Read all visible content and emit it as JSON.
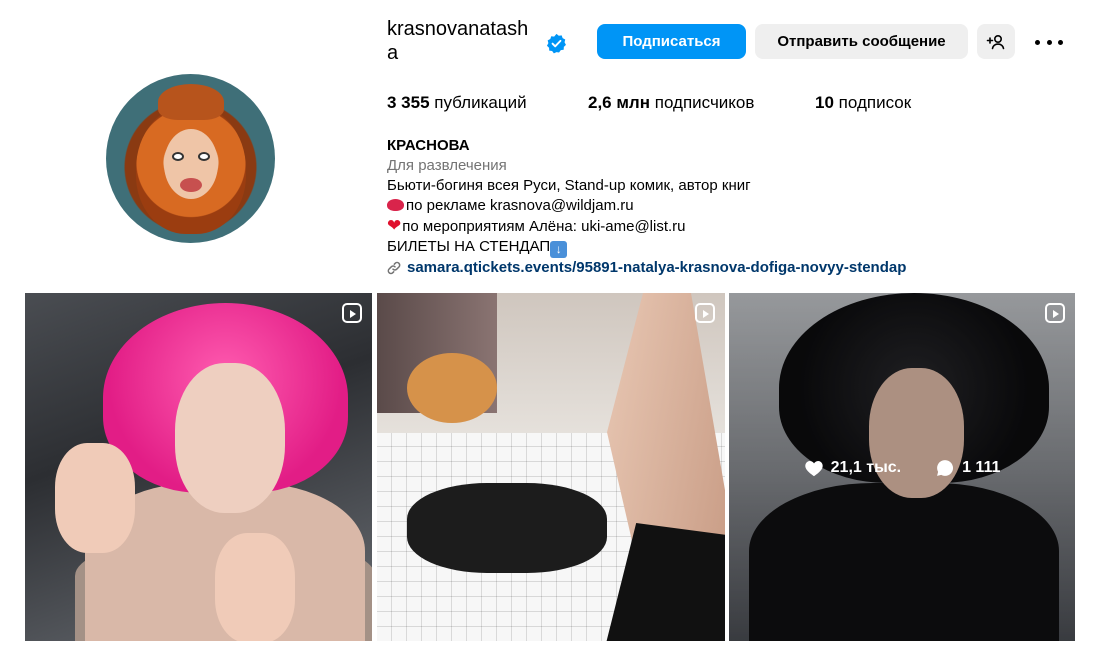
{
  "profile": {
    "username": "krasnovanatasha",
    "follow_label": "Подписаться",
    "message_label": "Отправить сообщение",
    "stats": {
      "posts_count": "3 355",
      "posts_label": "публикаций",
      "followers_count": "2,6 млн",
      "followers_label": "подписчиков",
      "following_count": "10",
      "following_label": "подписок"
    },
    "bio": {
      "name": "КРАСНОВА",
      "category": "Для развлечения",
      "line1": "Бьюти-богиня всея Руси, Stand-up комик, автор книг",
      "line2": "по рекламе krasnova@wildjam.ru",
      "line3": "по мероприятиям Алёна: uki-ame@list.ru",
      "line4": "БИЛЕТЫ НА СТЕНДАП",
      "link": "samara.qtickets.events/95891-natalya-krasnova-dofiga-novyy-stendap"
    }
  },
  "grid": {
    "hover_likes": "21,1 тыс.",
    "hover_comments": "1 111"
  },
  "colors": {
    "accent": "#0095f6",
    "link": "#00376b",
    "secondary_text": "#737373",
    "button_gray": "#efefef"
  }
}
